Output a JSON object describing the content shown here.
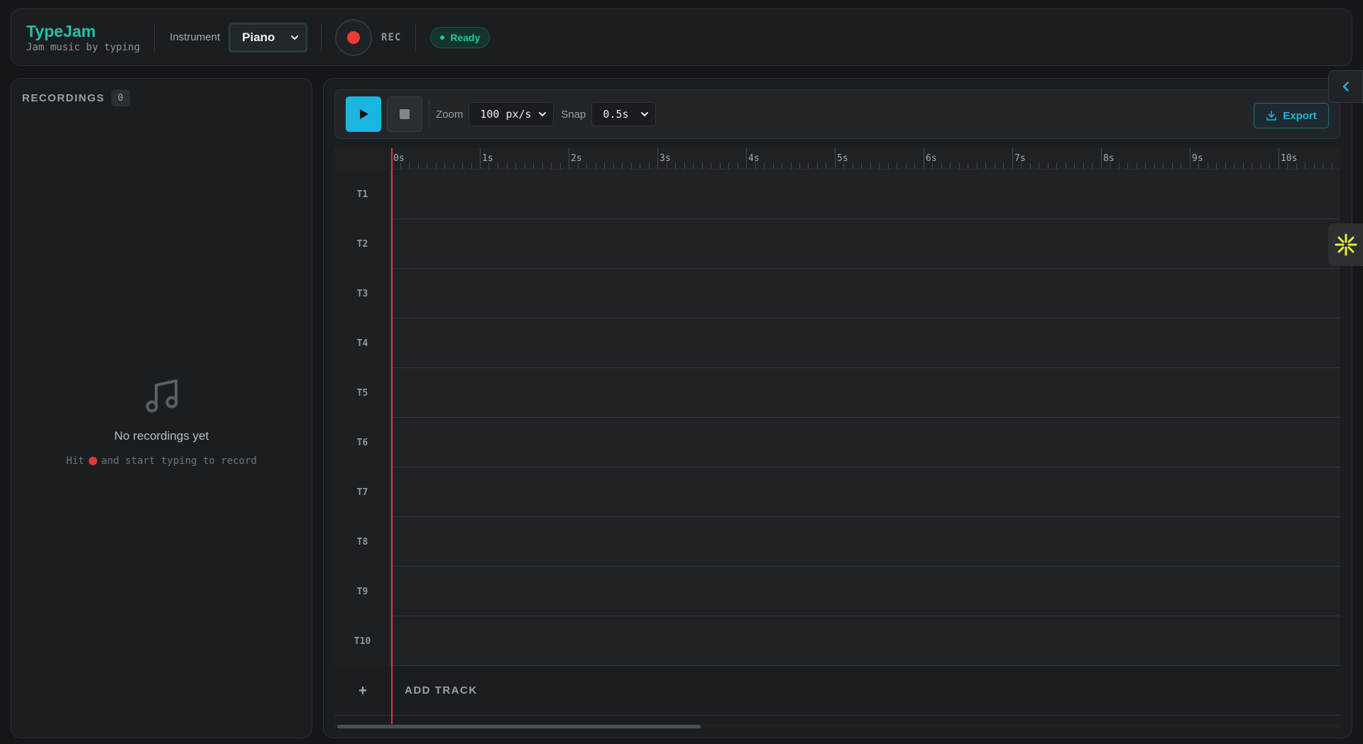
{
  "header": {
    "app_title": "TypeJam",
    "app_subtitle": "Jam music by typing",
    "instrument_label": "Instrument",
    "instrument_value": "Piano",
    "rec_label": "REC",
    "status": "Ready",
    "colors": {
      "accent": "#21c2a7",
      "record": "#ef3b35",
      "status": "#26c79e"
    }
  },
  "recordings": {
    "title": "RECORDINGS",
    "count": "0",
    "empty_icon": "music-note-icon",
    "empty_title": "No recordings yet",
    "hint_before": "Hit",
    "hint_after": "and start typing to record"
  },
  "toolbar": {
    "play_icon": "play-icon",
    "stop_icon": "stop-icon",
    "zoom_label": "Zoom",
    "zoom_value": "100 px/s",
    "snap_label": "Snap",
    "snap_value": "0.5s",
    "export_label": "Export",
    "colors": {
      "play": "#19b7e0",
      "export": "#1fb6dc"
    }
  },
  "timeline": {
    "ruler_labels": [
      "0s",
      "1s",
      "2s",
      "3s",
      "4s",
      "5s",
      "6s",
      "7s",
      "8s",
      "9s",
      "10s"
    ],
    "tracks": [
      "T1",
      "T2",
      "T3",
      "T4",
      "T5",
      "T6",
      "T7",
      "T8",
      "T9",
      "T10"
    ],
    "add_track_symbol": "+",
    "add_track_label": "ADD TRACK",
    "playhead_color": "#e2343a"
  },
  "side_tabs": {
    "collapse_icon": "chevron-left-icon",
    "assistant_icon": "sparkle-icon"
  }
}
